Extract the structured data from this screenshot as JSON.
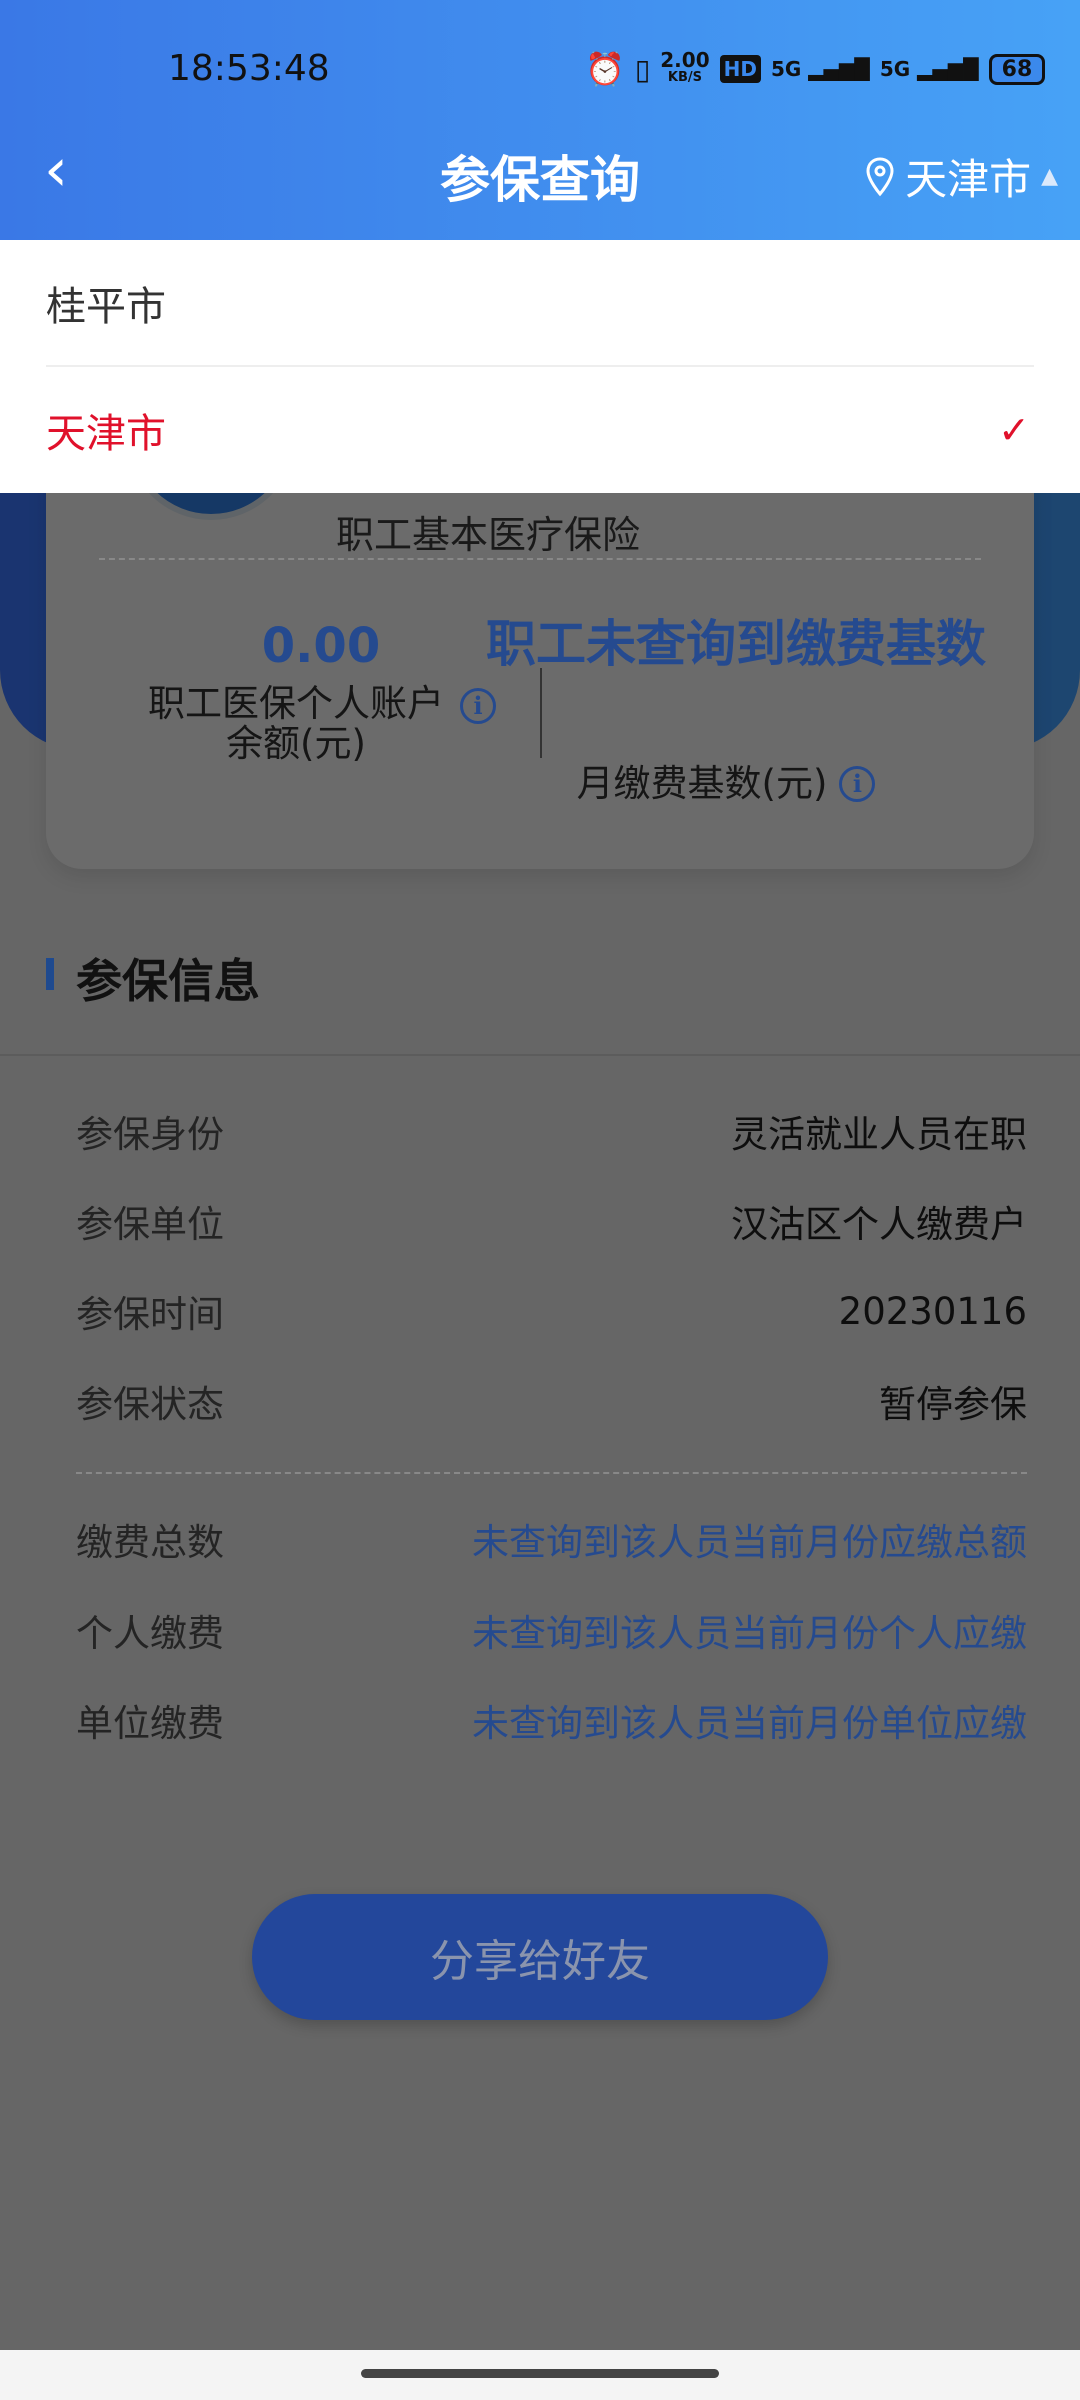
{
  "status_bar": {
    "time": "18:53:48",
    "net_speed": "2.00",
    "net_unit": "KB/S",
    "hd": "HD",
    "sim1": "5G",
    "sim2": "5G",
    "battery": "68"
  },
  "header": {
    "title": "参保查询",
    "city": "天津市"
  },
  "dropdown": {
    "options": [
      {
        "label": "桂平市",
        "selected": false
      },
      {
        "label": "天津市",
        "selected": true
      }
    ],
    "selected_color": "#e0112b"
  },
  "card": {
    "insurance_name": "职工基本医疗保险",
    "balance_value": "0.00",
    "balance_label": "职工医保个人账户余额(元)",
    "base_value": "职工未查询到缴费基数",
    "base_label": "月缴费基数(元)"
  },
  "section": {
    "title": "参保信息",
    "rows": [
      {
        "label": "参保身份",
        "value": "灵活就业人员在职"
      },
      {
        "label": "参保单位",
        "value": "汉沽区个人缴费户"
      },
      {
        "label": "参保时间",
        "value": "20230116"
      },
      {
        "label": "参保状态",
        "value": "暂停参保"
      }
    ],
    "pay_rows": [
      {
        "label": "缴费总数",
        "value": "未查询到该人员当前月份应缴总额"
      },
      {
        "label": "个人缴费",
        "value": "未查询到该人员当前月份个人应缴"
      },
      {
        "label": "单位缴费",
        "value": "未查询到该人员当前月份单位应缴"
      }
    ]
  },
  "share_button": "分享给好友"
}
